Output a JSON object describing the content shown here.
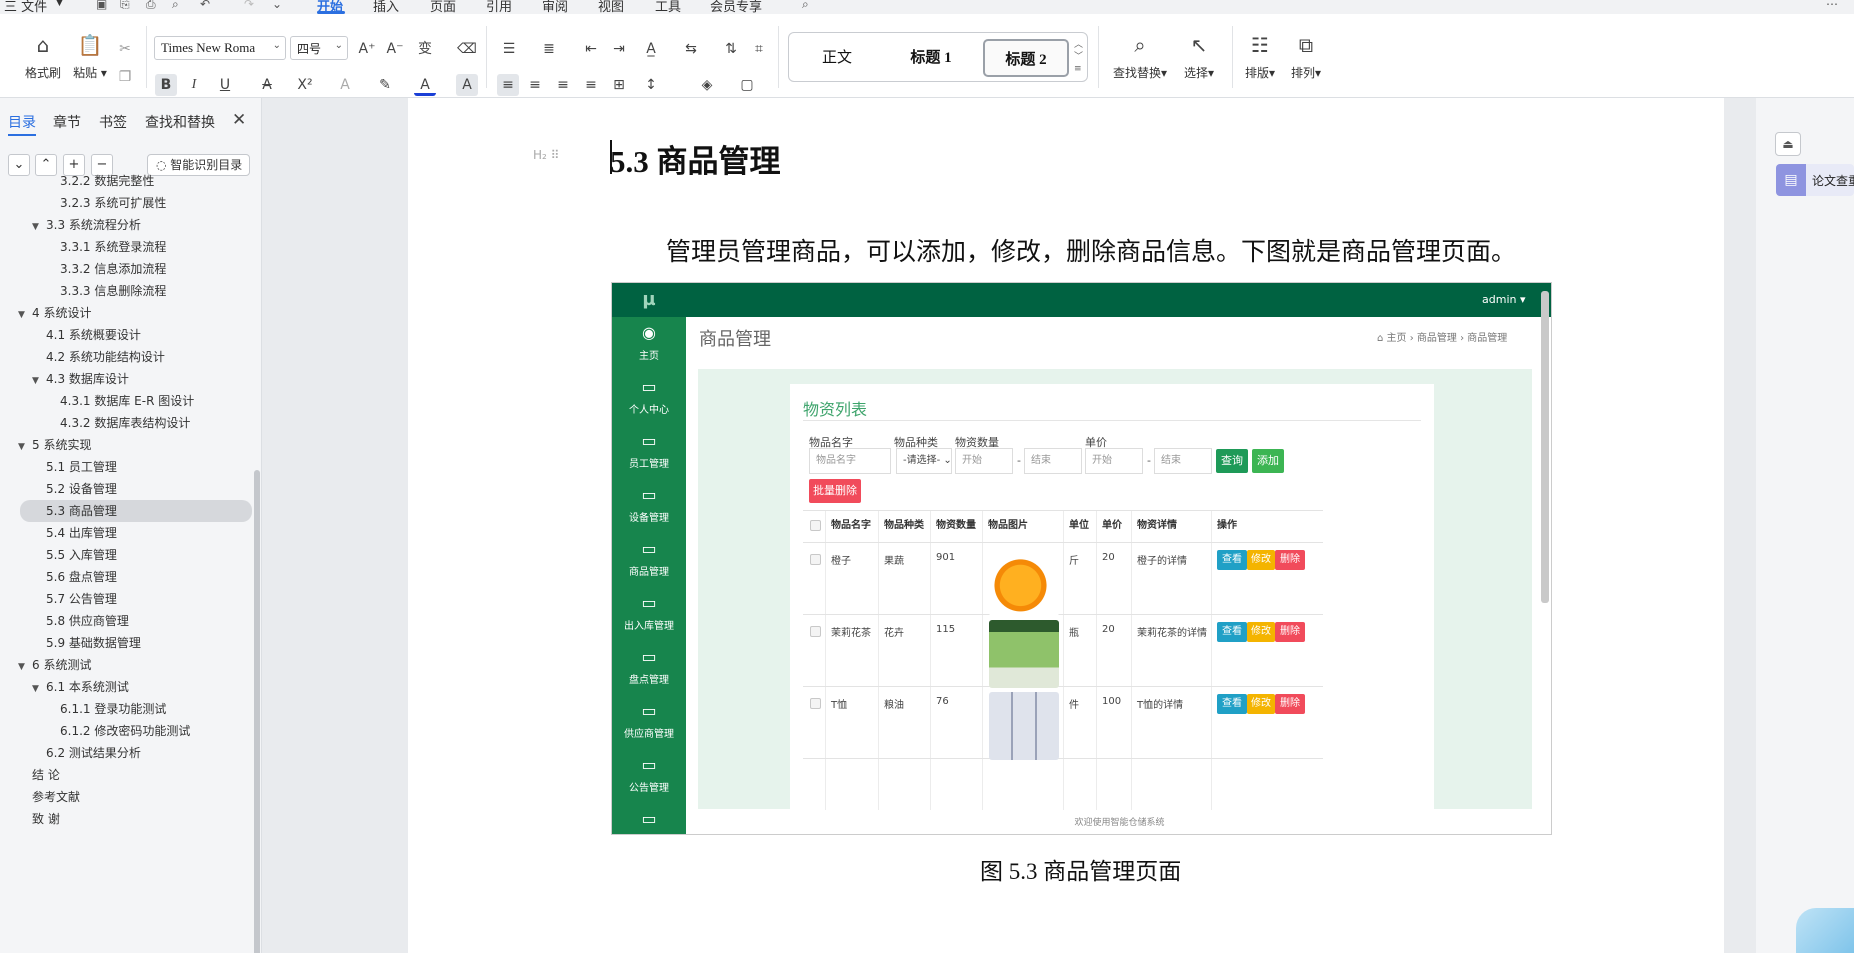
{
  "menubar": {
    "file": "三 文件",
    "tabs": [
      "开始",
      "插入",
      "页面",
      "引用",
      "审阅",
      "视图",
      "工具",
      "会员专享"
    ],
    "active_tab": "开始"
  },
  "ribbon": {
    "format_painter": "格式刷",
    "paste": "粘贴",
    "font_name": "Times New Roma",
    "font_size": "四号",
    "find_replace": "查找替换",
    "select": "选择",
    "layout": "排版",
    "arrange": "排列",
    "styles": [
      "正文",
      "标题 1",
      "标题 2"
    ],
    "selected_style": "标题 2"
  },
  "nav": {
    "tabs": [
      "目录",
      "章节",
      "书签",
      "查找和替换"
    ],
    "active_tab": "目录",
    "smart_toc": "智能识别目录",
    "toc": [
      {
        "label": "3.2.2 数据完整性",
        "level": 3,
        "expand": ""
      },
      {
        "label": "3.2.3 系统可扩展性",
        "level": 3,
        "expand": ""
      },
      {
        "label": "3.3 系统流程分析",
        "level": 2,
        "expand": "▼"
      },
      {
        "label": "3.3.1 系统登录流程",
        "level": 3,
        "expand": ""
      },
      {
        "label": "3.3.2 信息添加流程",
        "level": 3,
        "expand": ""
      },
      {
        "label": "3.3.3 信息删除流程",
        "level": 3,
        "expand": ""
      },
      {
        "label": "4 系统设计",
        "level": 1,
        "expand": "▼"
      },
      {
        "label": "4.1 系统概要设计",
        "level": 2,
        "expand": ""
      },
      {
        "label": "4.2 系统功能结构设计",
        "level": 2,
        "expand": ""
      },
      {
        "label": "4.3 数据库设计",
        "level": 2,
        "expand": "▼"
      },
      {
        "label": "4.3.1 数据库 E-R 图设计",
        "level": 3,
        "expand": ""
      },
      {
        "label": "4.3.2 数据库表结构设计",
        "level": 3,
        "expand": ""
      },
      {
        "label": "5 系统实现",
        "level": 1,
        "expand": "▼"
      },
      {
        "label": "5.1 员工管理",
        "level": 2,
        "expand": ""
      },
      {
        "label": "5.2 设备管理",
        "level": 2,
        "expand": ""
      },
      {
        "label": "5.3 商品管理",
        "level": 2,
        "expand": "",
        "selected": true
      },
      {
        "label": "5.4 出库管理",
        "level": 2,
        "expand": ""
      },
      {
        "label": "5.5 入库管理",
        "level": 2,
        "expand": ""
      },
      {
        "label": "5.6 盘点管理",
        "level": 2,
        "expand": ""
      },
      {
        "label": "5.7 公告管理",
        "level": 2,
        "expand": ""
      },
      {
        "label": "5.8 供应商管理",
        "level": 2,
        "expand": ""
      },
      {
        "label": "5.9 基础数据管理",
        "level": 2,
        "expand": ""
      },
      {
        "label": "6 系统测试",
        "level": 1,
        "expand": "▼"
      },
      {
        "label": "6.1 本系统测试",
        "level": 2,
        "expand": "▼"
      },
      {
        "label": "6.1.1 登录功能测试",
        "level": 3,
        "expand": ""
      },
      {
        "label": "6.1.2 修改密码功能测试",
        "level": 3,
        "expand": ""
      },
      {
        "label": "6.2 测试结果分析",
        "level": 2,
        "expand": ""
      },
      {
        "label": "结 论",
        "level": 1,
        "expand": ""
      },
      {
        "label": "参考文献",
        "level": 1,
        "expand": ""
      },
      {
        "label": "致 谢",
        "level": 1,
        "expand": ""
      }
    ]
  },
  "document": {
    "heading_marker": "H₂",
    "heading": "5.3  商品管理",
    "paragraph": "管理员管理商品，可以添加，修改，删除商品信息。下图就是商品管理页面。",
    "caption": "图 5.3 商品管理页面"
  },
  "screenshot": {
    "logo": "µ",
    "admin": "admin ▾",
    "sidebar": [
      "主页",
      "个人中心",
      "员工管理",
      "设备管理",
      "商品管理",
      "出入库管理",
      "盘点管理",
      "供应商管理",
      "公告管理"
    ],
    "page_title": "商品管理",
    "breadcrumb": "主页  ›  商品管理  ›  商品管理",
    "panel_title": "物资列表",
    "filters": {
      "name_label": "物品名字",
      "type_label": "物品种类",
      "qty_label": "物资数量",
      "price_label": "单价",
      "name_placeholder": "物品名字",
      "type_select": "-请选择-",
      "start": "开始",
      "end": "结束"
    },
    "buttons": {
      "query": "查询",
      "add": "添加",
      "batch_delete": "批量删除"
    },
    "columns": [
      "物品名字",
      "物品种类",
      "物资数量",
      "物品图片",
      "单位",
      "单价",
      "物资详情",
      "操作"
    ],
    "rows": [
      {
        "name": "橙子",
        "type": "果蔬",
        "qty": "901",
        "unit": "斤",
        "price": "20",
        "detail": "橙子的详情"
      },
      {
        "name": "茉莉花茶",
        "type": "花卉",
        "qty": "115",
        "unit": "瓶",
        "price": "20",
        "detail": "茉莉花茶的详情"
      },
      {
        "name": "T恤",
        "type": "粮油",
        "qty": "76",
        "unit": "件",
        "price": "100",
        "detail": "T恤的详情"
      }
    ],
    "row_actions": {
      "view": "查看",
      "edit": "修改",
      "delete": "删除"
    },
    "footer": "欢迎使用智能仓储系统"
  },
  "right_panel": {
    "paper_check": "论文查重"
  },
  "colors": {
    "accent": "#2b6fe0",
    "nav_green": "#17854d",
    "top_green": "#006241",
    "query_green": "#1e9a58",
    "delete_red": "#f14b5b",
    "view_blue": "#20a0c6",
    "edit_orange": "#f4b400"
  }
}
